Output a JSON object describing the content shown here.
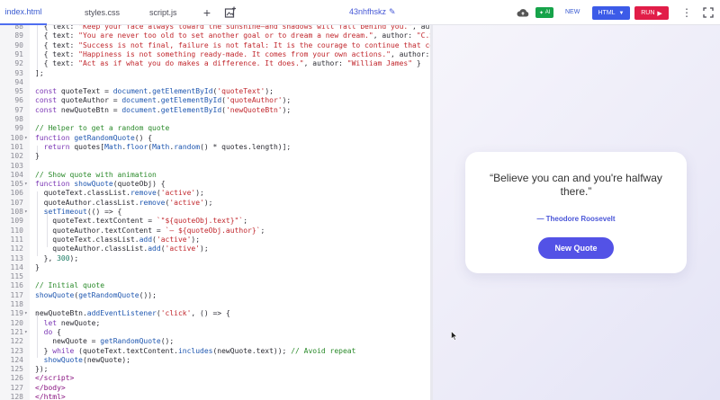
{
  "tabs": {
    "html": "index.html",
    "css": "styles.css",
    "js": "script.js"
  },
  "toolbar": {
    "project_name": "43nhfhskz",
    "ai_label": "AI",
    "new_label": "NEW",
    "language_label": "HTML",
    "run_label": "RUN"
  },
  "editor": {
    "lines": [
      {
        "n": "88",
        "fold": "",
        "html": "  { text: <span class='s'>\"Keep your face always toward the sunshine—and shadows will fall behind you.\"</span>, author: <span class='s'>\"Walt</span>"
      },
      {
        "n": "89",
        "fold": "",
        "html": "  { text: <span class='s'>\"You are never too old to set another goal or to dream a new dream.\"</span>, author: <span class='s'>\"C.S. Le</span>"
      },
      {
        "n": "90",
        "fold": "",
        "html": "  { text: <span class='s'>\"Success is not final, failure is not fatal: It is the courage to continue that counts</span>"
      },
      {
        "n": "91",
        "fold": "",
        "html": "  { text: <span class='s'>\"Happiness is not something ready-made. It comes from your own actions.\"</span>, author: <span class='s'>\"Dal</span>"
      },
      {
        "n": "92",
        "fold": "",
        "html": "  { text: <span class='s'>\"Act as if what you do makes a difference. It does.\"</span>, author: <span class='s'>\"William James\"</span> }"
      },
      {
        "n": "93",
        "fold": "",
        "html": "];"
      },
      {
        "n": "94",
        "fold": "",
        "html": ""
      },
      {
        "n": "95",
        "fold": "",
        "html": "<span class='k'>const</span> quoteText = <span class='f'>document</span>.<span class='f'>getElementById</span>(<span class='s'>'quoteText'</span>);"
      },
      {
        "n": "96",
        "fold": "",
        "html": "<span class='k'>const</span> quoteAuthor = <span class='f'>document</span>.<span class='f'>getElementById</span>(<span class='s'>'quoteAuthor'</span>);"
      },
      {
        "n": "97",
        "fold": "",
        "html": "<span class='k'>const</span> newQuoteBtn = <span class='f'>document</span>.<span class='f'>getElementById</span>(<span class='s'>'newQuoteBtn'</span>);"
      },
      {
        "n": "98",
        "fold": "",
        "html": ""
      },
      {
        "n": "99",
        "fold": "",
        "html": "<span class='c'>// Helper to get a random quote</span>"
      },
      {
        "n": "100",
        "fold": "▾",
        "html": "<span class='k'>function</span> <span class='f'>getRandomQuote</span>() {"
      },
      {
        "n": "101",
        "fold": "",
        "html": "  <span class='k'>return</span> quotes[<span class='f'>Math</span>.<span class='f'>floor</span>(<span class='f'>Math</span>.<span class='f'>random</span>() * quotes.length)];"
      },
      {
        "n": "102",
        "fold": "",
        "html": "}"
      },
      {
        "n": "103",
        "fold": "",
        "html": ""
      },
      {
        "n": "104",
        "fold": "",
        "html": "<span class='c'>// Show quote with animation</span>"
      },
      {
        "n": "105",
        "fold": "▾",
        "html": "<span class='k'>function</span> <span class='f'>showQuote</span>(quoteObj) {"
      },
      {
        "n": "106",
        "fold": "",
        "html": "  quoteText.classList.<span class='f'>remove</span>(<span class='s'>'active'</span>);"
      },
      {
        "n": "107",
        "fold": "",
        "html": "  quoteAuthor.classList.<span class='f'>remove</span>(<span class='s'>'active'</span>);"
      },
      {
        "n": "108",
        "fold": "▾",
        "html": "  <span class='f'>setTimeout</span>(() => {"
      },
      {
        "n": "109",
        "fold": "",
        "html": "    quoteText.textContent = <span class='s'>`\"${quoteObj.text}\"`</span>;"
      },
      {
        "n": "110",
        "fold": "",
        "html": "    quoteAuthor.textContent = <span class='s'>`— ${quoteObj.author}`</span>;"
      },
      {
        "n": "111",
        "fold": "",
        "html": "    quoteText.classList.<span class='f'>add</span>(<span class='s'>'active'</span>);"
      },
      {
        "n": "112",
        "fold": "",
        "html": "    quoteAuthor.classList.<span class='f'>add</span>(<span class='s'>'active'</span>);"
      },
      {
        "n": "113",
        "fold": "",
        "html": "  }, <span class='n'>300</span>);"
      },
      {
        "n": "114",
        "fold": "",
        "html": "}"
      },
      {
        "n": "115",
        "fold": "",
        "html": ""
      },
      {
        "n": "116",
        "fold": "",
        "html": "<span class='c'>// Initial quote</span>"
      },
      {
        "n": "117",
        "fold": "",
        "html": "<span class='f'>showQuote</span>(<span class='f'>getRandomQuote</span>());"
      },
      {
        "n": "118",
        "fold": "",
        "html": ""
      },
      {
        "n": "119",
        "fold": "▾",
        "html": "newQuoteBtn.<span class='f'>addEventListener</span>(<span class='s'>'click'</span>, () => {"
      },
      {
        "n": "120",
        "fold": "",
        "html": "  <span class='k'>let</span> newQuote;"
      },
      {
        "n": "121",
        "fold": "▾",
        "html": "  <span class='k'>do</span> {"
      },
      {
        "n": "122",
        "fold": "",
        "html": "    newQuote = <span class='f'>getRandomQuote</span>();"
      },
      {
        "n": "123",
        "fold": "",
        "html": "  } <span class='k'>while</span> (quoteText.textContent.<span class='f'>includes</span>(newQuote.text)); <span class='c'>// Avoid repeat</span>"
      },
      {
        "n": "124",
        "fold": "",
        "html": "  <span class='f'>showQuote</span>(newQuote);"
      },
      {
        "n": "125",
        "fold": "",
        "html": "});"
      },
      {
        "n": "126",
        "fold": "",
        "html": "<span class='tg'>&lt;/script&gt;</span>"
      },
      {
        "n": "127",
        "fold": "",
        "html": "<span class='tg'>&lt;/body&gt;</span>"
      },
      {
        "n": "128",
        "fold": "",
        "html": "<span class='tg'>&lt;/html&gt;</span>"
      },
      {
        "n": "129",
        "fold": "",
        "html": ""
      }
    ]
  },
  "preview": {
    "quote_text": "“Believe you can and you're halfway there.”",
    "quote_author": "— Theodore Roosevelt",
    "button_label": "New Quote"
  },
  "colors": {
    "accent": "#4f6ef0",
    "run": "#e11d48",
    "button": "#5352e6"
  }
}
